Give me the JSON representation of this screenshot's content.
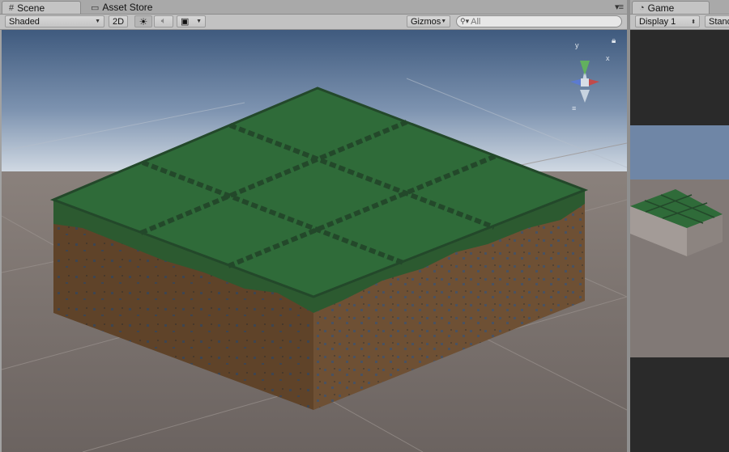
{
  "scene_panel": {
    "tabs": [
      {
        "label": "Scene",
        "icon": "grid-icon",
        "active": true
      },
      {
        "label": "Asset Store",
        "icon": "store-icon",
        "active": false
      }
    ],
    "toolbar": {
      "draw_mode": "Shaded",
      "toggle_2d": "2D",
      "gizmos": "Gizmos",
      "search_placeholder": "All"
    },
    "gizmo": {
      "y_label": "y",
      "x_label": "x"
    }
  },
  "game_panel": {
    "tab": {
      "label": "Game",
      "icon": "pacman-icon"
    },
    "toolbar": {
      "display": "Display 1",
      "aspect": "Stand"
    }
  },
  "colors": {
    "grass": "#2f6b39",
    "dirt": "#6b4d2f",
    "sky_top": "#3f5a7e",
    "ground": "#6e6663",
    "game_bg": "#2a2a2a"
  }
}
